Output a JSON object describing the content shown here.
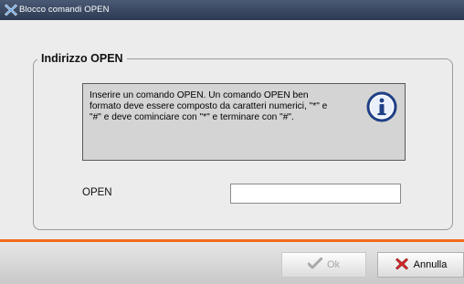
{
  "window": {
    "title": "Blocco comandi OPEN",
    "icon": "app-x-icon"
  },
  "group": {
    "legend": "Indirizzo OPEN",
    "info": {
      "line1": "Inserire un comando OPEN. Un comando OPEN ben",
      "line2": "formato deve essere composto da caratteri numerici, \"*\" e",
      "line3": "\"#\" e deve cominciare con \"*\" e terminare con \"#\".",
      "icon": "info-icon"
    },
    "field": {
      "label": "OPEN",
      "value": "",
      "placeholder": ""
    }
  },
  "footer": {
    "ok": {
      "label": "Ok",
      "icon": "checkmark-icon",
      "enabled": false
    },
    "cancel": {
      "label": "Annulla",
      "icon": "red-x-icon"
    }
  },
  "colors": {
    "accent_line": "#f26a1b",
    "titlebar": "#2d3a52"
  }
}
